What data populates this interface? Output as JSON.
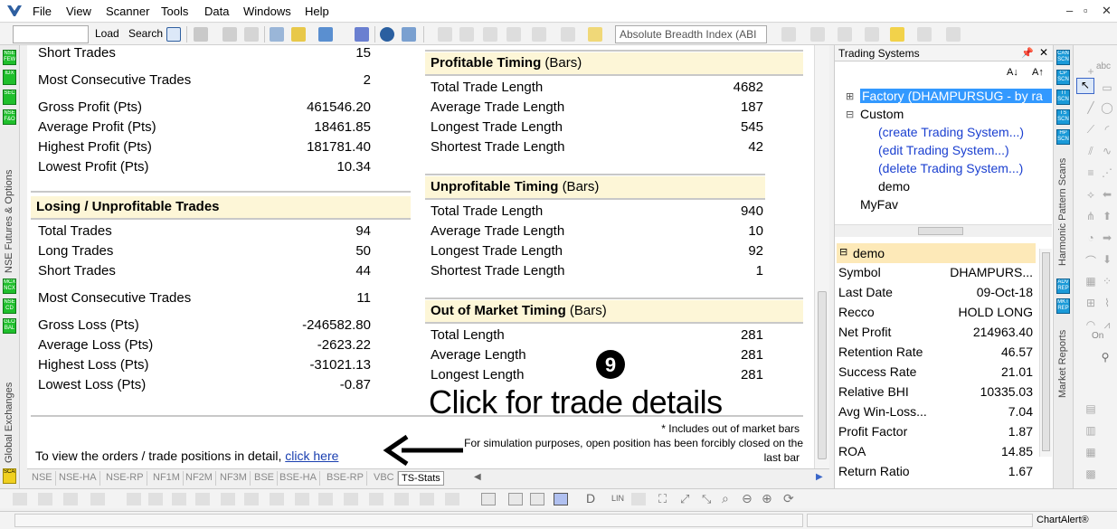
{
  "menu": {
    "items": [
      "File",
      "View",
      "Scanner",
      "Tools",
      "Data",
      "Windows",
      "Help"
    ]
  },
  "toolbar": {
    "load_label": "Load",
    "search_label": "Search",
    "indicator_select": "Absolute Breadth Index (ABI"
  },
  "left_strip": {
    "icons": [
      "NSE FEW",
      "IDX",
      "SEC",
      "NSE F&O",
      "MCX NCX",
      "NSE CD",
      "GLO BAL",
      "SCAN"
    ],
    "section1": "NSE Futures & Options",
    "section2": "Global Exchanges"
  },
  "winning": {
    "rows": [
      {
        "label": "Short Trades",
        "value": "15"
      },
      {
        "label": "Most Consecutive Trades",
        "value": "2"
      },
      {
        "label": "Gross Profit (Pts)",
        "value": "461546.20"
      },
      {
        "label": "Average Profit (Pts)",
        "value": "18461.85"
      },
      {
        "label": "Highest Profit (Pts)",
        "value": "181781.40"
      },
      {
        "label": "Lowest Profit (Pts)",
        "value": "10.34"
      }
    ]
  },
  "losing": {
    "title": "Losing / Unprofitable Trades",
    "rows": [
      {
        "label": "Total Trades",
        "value": "94"
      },
      {
        "label": "Long Trades",
        "value": "50"
      },
      {
        "label": "Short Trades",
        "value": "44"
      },
      {
        "label": "Most Consecutive Trades",
        "value": "11"
      },
      {
        "label": "Gross Loss (Pts)",
        "value": "-246582.80"
      },
      {
        "label": "Average Loss (Pts)",
        "value": "-2623.22"
      },
      {
        "label": "Highest Loss (Pts)",
        "value": "-31021.13"
      },
      {
        "label": "Lowest Loss (Pts)",
        "value": "-0.87"
      }
    ]
  },
  "profitable_timing": {
    "title": "Profitable Timing",
    "unit": "(Bars)",
    "rows": [
      {
        "label": "Total Trade Length",
        "value": "4682"
      },
      {
        "label": "Average Trade Length",
        "value": "187"
      },
      {
        "label": "Longest Trade Length",
        "value": "545"
      },
      {
        "label": "Shortest Trade Length",
        "value": "42"
      }
    ]
  },
  "unprofitable_timing": {
    "title": "Unprofitable Timing",
    "unit": "(Bars)",
    "rows": [
      {
        "label": "Total Trade Length",
        "value": "940"
      },
      {
        "label": "Average Trade Length",
        "value": "10"
      },
      {
        "label": "Longest Trade Length",
        "value": "92"
      },
      {
        "label": "Shortest Trade Length",
        "value": "1"
      }
    ]
  },
  "out_of_market": {
    "title": "Out of Market Timing",
    "unit": "(Bars)",
    "rows": [
      {
        "label": "Total Length",
        "value": "281"
      },
      {
        "label": "Average Length",
        "value": "281"
      },
      {
        "label": "Longest Length",
        "value": "281"
      }
    ]
  },
  "annotation": {
    "step_number": "9",
    "caption": "Click for trade details"
  },
  "notes": {
    "line1": "* Includes out of market bars",
    "line2": "For simulation purposes, open position has been forcibly closed on the",
    "line3": "last bar"
  },
  "footer_link": {
    "prefix": "To view the orders / trade positions in detail,",
    "link": "click here"
  },
  "tabs": [
    "NSE",
    "NSE-HA",
    "NSE-RP",
    "NF1M",
    "NF2M",
    "NF3M",
    "BSE",
    "BSE-HA",
    "BSE-RP",
    "VBC",
    "TS-Stats"
  ],
  "trading_systems": {
    "title": "Trading Systems",
    "tree": [
      {
        "label": "Factory (DHAMPURSUG - by ra",
        "selected": true
      },
      {
        "label": "Custom"
      },
      {
        "label": "(create Trading System...)",
        "link": true
      },
      {
        "label": "(edit Trading System...)",
        "link": true
      },
      {
        "label": "(delete Trading System...)",
        "link": true
      },
      {
        "label": "demo"
      },
      {
        "label": "MyFav"
      }
    ]
  },
  "properties": {
    "title": "demo",
    "rows": [
      {
        "label": "Symbol",
        "value": "DHAMPURS..."
      },
      {
        "label": "Last Date",
        "value": "09-Oct-18"
      },
      {
        "label": "Recco",
        "value": "HOLD LONG"
      },
      {
        "label": "Net Profit",
        "value": "214963.40"
      },
      {
        "label": "Retention Rate",
        "value": "46.57"
      },
      {
        "label": "Success Rate",
        "value": "21.01"
      },
      {
        "label": "Relative BHI",
        "value": "10335.03"
      },
      {
        "label": "Avg Win-Loss...",
        "value": "7.04"
      },
      {
        "label": "Profit Factor",
        "value": "1.87"
      },
      {
        "label": "ROA",
        "value": "14.85"
      },
      {
        "label": "Return Ratio",
        "value": "1.67"
      }
    ]
  },
  "right_strip": {
    "icons": [
      "CAN SCN",
      "CP SCN",
      "TI SCN",
      "TS SCN",
      "HP SCN",
      "ADV REP",
      "MKT REP"
    ],
    "section1": "Harmonic Pattern Scans",
    "section2": "Market Reports"
  },
  "drawbar": {
    "text_tool": "abc",
    "on_label": "On"
  },
  "bottom_toolbar": {
    "lin_label": "LIN"
  },
  "status": {
    "brand": "ChartAlert®"
  }
}
